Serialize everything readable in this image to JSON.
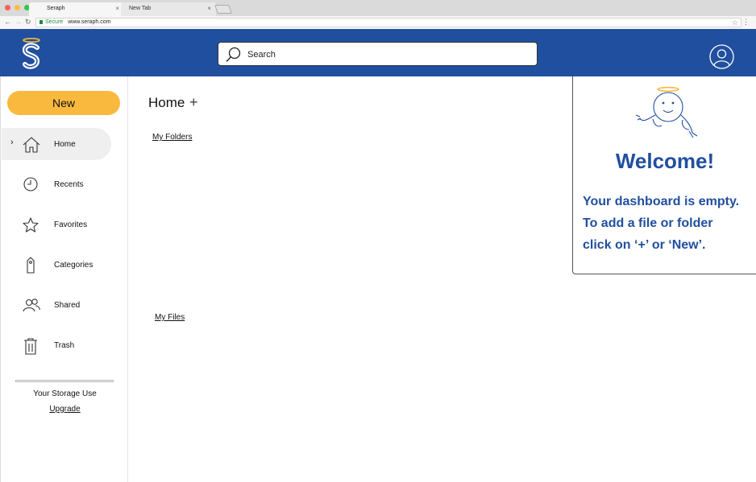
{
  "browser": {
    "tabs": [
      {
        "label": "Seraph",
        "close": "×"
      },
      {
        "label": "New Tab",
        "close": "×"
      }
    ],
    "secure_label": "Secure",
    "url": "www.seraph.com"
  },
  "header": {
    "search_placeholder": "Search",
    "brand_color": "#214f9f"
  },
  "sidebar": {
    "new_label": "New",
    "items": [
      {
        "label": "Home",
        "icon": "home-icon",
        "active": true
      },
      {
        "label": "Recents",
        "icon": "clock-icon"
      },
      {
        "label": "Favorites",
        "icon": "star-icon"
      },
      {
        "label": "Categories",
        "icon": "tag-icon"
      },
      {
        "label": "Shared",
        "icon": "people-icon"
      },
      {
        "label": "Trash",
        "icon": "trash-icon"
      }
    ],
    "storage_label": "Your Storage Use",
    "upgrade_label": "Upgrade",
    "accent_color": "#f9b93f"
  },
  "main": {
    "title": "Home",
    "add_symbol": "+",
    "folders_label": "My Folders",
    "files_label": "My Files"
  },
  "welcome": {
    "title": "Welcome!",
    "lines": [
      "Your dashboard is empty.",
      "To add a file or folder",
      "click on ‘+’ or ‘New’."
    ]
  }
}
